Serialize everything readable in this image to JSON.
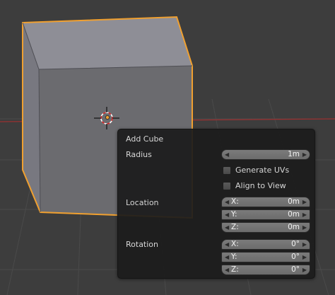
{
  "panel": {
    "title": "Add Cube",
    "radius_label": "Radius",
    "radius_value": "1m",
    "generate_uvs_label": "Generate UVs",
    "generate_uvs_checked": false,
    "align_to_view_label": "Align to View",
    "align_to_view_checked": false,
    "location_label": "Location",
    "location": [
      {
        "axis": "X:",
        "value": "0m"
      },
      {
        "axis": "Y:",
        "value": "0m"
      },
      {
        "axis": "Z:",
        "value": "0m"
      }
    ],
    "rotation_label": "Rotation",
    "rotation": [
      {
        "axis": "X:",
        "value": "0°"
      },
      {
        "axis": "Y:",
        "value": "0°"
      },
      {
        "axis": "Z:",
        "value": "0°"
      }
    ]
  },
  "colors": {
    "background": "#3d3d3d",
    "grid": "#4a4a4a",
    "x_axis": "#9a3030",
    "cube_front": "#6b6b6f",
    "cube_top": "#8e8e96",
    "cube_left": "#787880",
    "selection_outline": "#f0a030"
  },
  "icons": [
    "3d-cursor-icon",
    "origin-dot-icon",
    "left-arrow-icon",
    "right-arrow-icon",
    "checkbox-icon"
  ]
}
